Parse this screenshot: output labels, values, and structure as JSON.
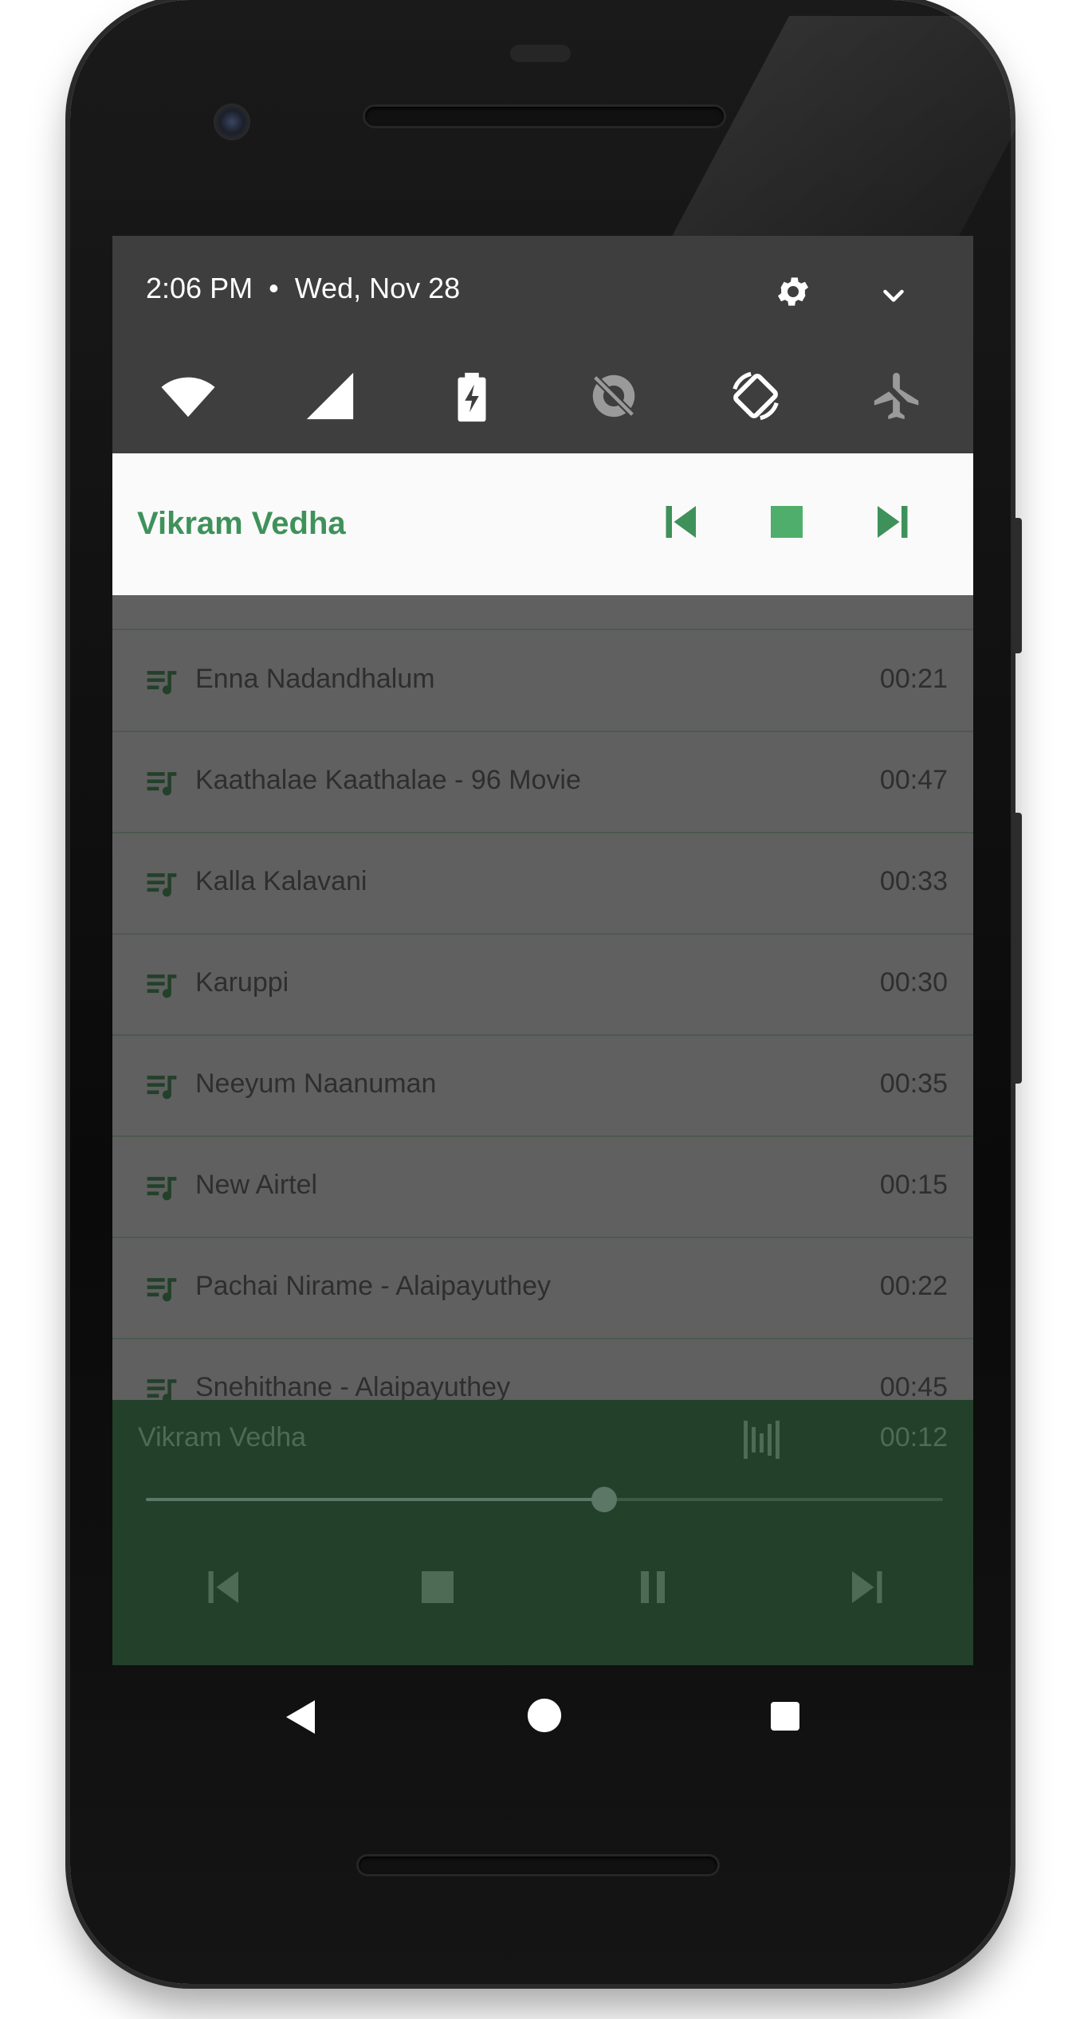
{
  "status": {
    "time": "2:06 PM",
    "separator": "•",
    "date": "Wed, Nov 28"
  },
  "quick_settings": {
    "tiles": [
      "wifi-icon",
      "cell-signal-icon",
      "battery-charging-icon",
      "data-saver-off-icon",
      "auto-rotate-icon",
      "airplane-mode-icon"
    ]
  },
  "notification": {
    "title": "Vikram Vedha",
    "accent_color": "#3f915a"
  },
  "playlist": {
    "rows": [
      {
        "title": "Enna Nadandhalum",
        "duration": "00:21"
      },
      {
        "title": "Kaathalae Kaathalae - 96 Movie",
        "duration": "00:47"
      },
      {
        "title": "Kalla Kalavani",
        "duration": "00:33"
      },
      {
        "title": "Karuppi",
        "duration": "00:30"
      },
      {
        "title": "Neeyum Naanuman",
        "duration": "00:35"
      },
      {
        "title": "New Airtel",
        "duration": "00:15"
      },
      {
        "title": "Pachai Nirame - Alaipayuthey",
        "duration": "00:22"
      },
      {
        "title": "Snehithane - Alaipayuthey",
        "duration": "00:45"
      }
    ]
  },
  "player": {
    "title": "Vikram Vedha",
    "elapsed": "00:12",
    "progress": 0.575,
    "background_color": "#23402a"
  }
}
